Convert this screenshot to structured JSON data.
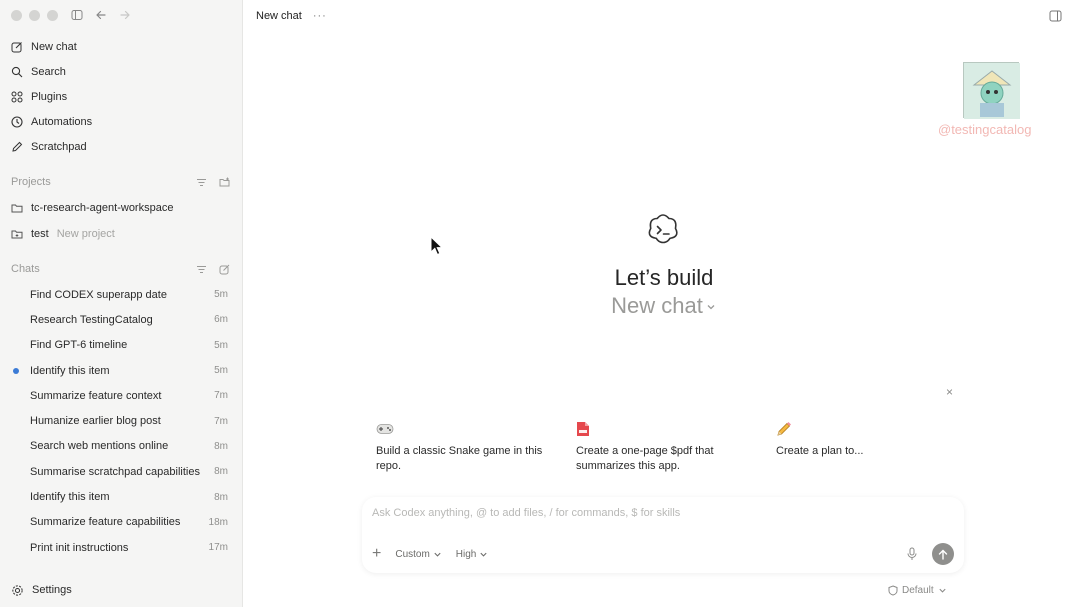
{
  "sidebar": {
    "nav": [
      {
        "label": "New chat",
        "icon": "compose-icon"
      },
      {
        "label": "Search",
        "icon": "search-icon"
      },
      {
        "label": "Plugins",
        "icon": "plugins-grid-icon"
      },
      {
        "label": "Automations",
        "icon": "clock-icon"
      },
      {
        "label": "Scratchpad",
        "icon": "pencil-icon"
      }
    ],
    "projects_label": "Projects",
    "projects": [
      {
        "name": "tc-research-agent-workspace",
        "sub": ""
      },
      {
        "name": "test",
        "sub": "New project"
      }
    ],
    "chats_label": "Chats",
    "chats": [
      {
        "title": "Find CODEX superapp date",
        "time": "5m",
        "unread": false
      },
      {
        "title": "Research TestingCatalog",
        "time": "6m",
        "unread": false
      },
      {
        "title": "Find GPT-6 timeline",
        "time": "5m",
        "unread": false
      },
      {
        "title": "Identify this item",
        "time": "5m",
        "unread": true
      },
      {
        "title": "Summarize feature context",
        "time": "7m",
        "unread": false
      },
      {
        "title": "Humanize earlier blog post",
        "time": "7m",
        "unread": false
      },
      {
        "title": "Search web mentions online",
        "time": "8m",
        "unread": false
      },
      {
        "title": "Summarise scratchpad capabilities",
        "time": "8m",
        "unread": false
      },
      {
        "title": "Identify this item",
        "time": "8m",
        "unread": false
      },
      {
        "title": "Summarize feature capabilities",
        "time": "18m",
        "unread": false
      },
      {
        "title": "Print init instructions",
        "time": "17m",
        "unread": false
      }
    ],
    "settings_label": "Settings"
  },
  "topbar": {
    "title": "New chat",
    "more": "···"
  },
  "watermark": "@testingcatalog",
  "hero": {
    "title": "Let’s build",
    "subtitle": "New chat"
  },
  "close": "×",
  "suggestions": [
    {
      "icon": "gamepad-icon",
      "text": "Build a classic Snake game in this repo."
    },
    {
      "icon": "pdf-icon",
      "text": "Create a one-page $pdf that summarizes this app."
    },
    {
      "icon": "pencil-emoji-icon",
      "text": "Create a plan to..."
    }
  ],
  "composer": {
    "placeholder": "Ask Codex anything, @ to add files, / for commands, $ for skills",
    "plus": "+",
    "mode": "Custom",
    "effort": "High"
  },
  "footer": {
    "permission": "Default"
  },
  "colors": {
    "sidebar_bg": "#f5f5f4",
    "unread_dot": "#3b7bd6",
    "watermark": "#f2b8b4",
    "send_button": "#8f8f8d"
  }
}
